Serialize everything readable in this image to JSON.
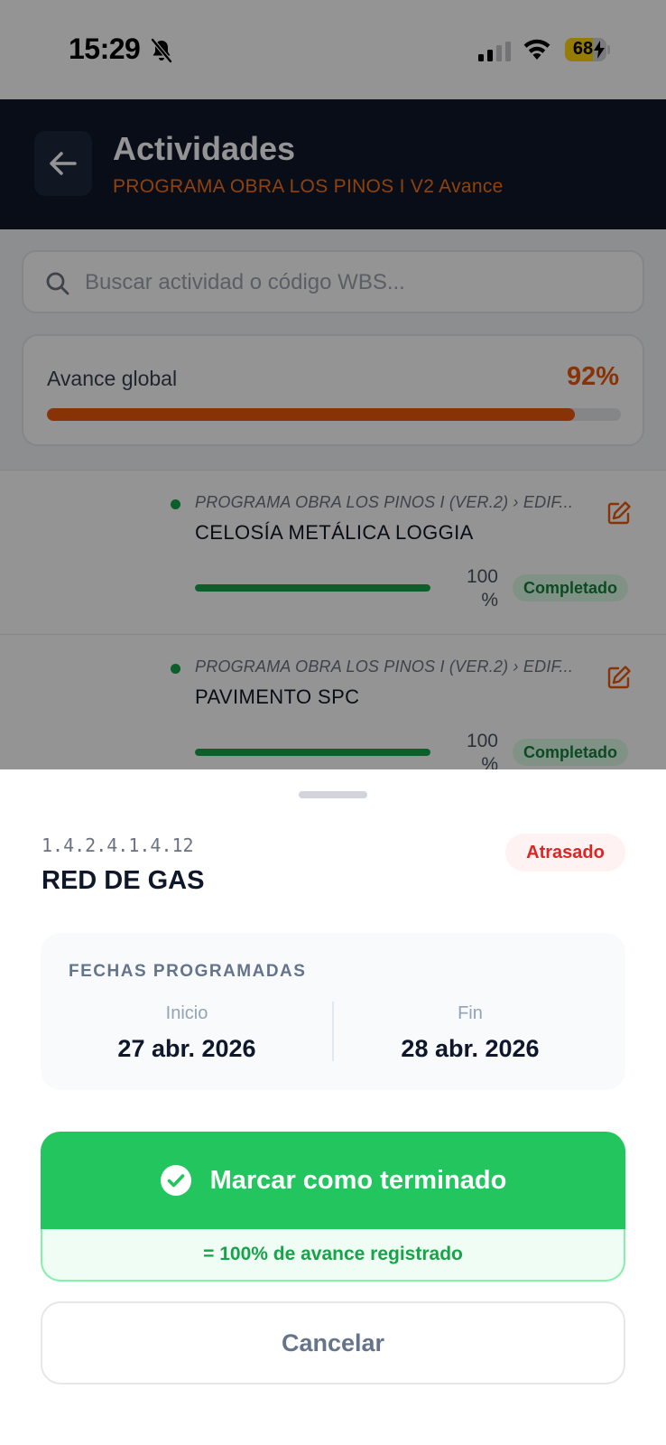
{
  "status_bar": {
    "time": "15:29",
    "battery": "68",
    "battery_level": 68,
    "icons": [
      "bell-slash-icon",
      "cellular-signal-icon",
      "wifi-icon",
      "battery-charging-icon"
    ]
  },
  "header": {
    "title": "Actividades",
    "subtitle": "PROGRAMA OBRA LOS PINOS I V2 Avance",
    "back_icon": "arrow-left-icon"
  },
  "search": {
    "placeholder": "Buscar actividad o código WBS..."
  },
  "global_progress": {
    "label": "Avance global",
    "value_text": "92%",
    "value": 92
  },
  "activities": [
    {
      "path": "PROGRAMA OBRA LOS PINOS I (VER.2) › EDIF...",
      "name": "CELOSÍA METÁLICA LOGGIA",
      "progress": 100,
      "percent_text": "100 %",
      "status": "Completado"
    },
    {
      "path": "PROGRAMA OBRA LOS PINOS I (VER.2) › EDIF...",
      "name": "PAVIMENTO SPC",
      "progress": 100,
      "percent_text": "100 %",
      "status": "Completado"
    }
  ],
  "sheet": {
    "wbs_code": "1.4.2.4.1.4.12",
    "title": "RED DE GAS",
    "status_badge": "Atrasado",
    "dates": {
      "heading": "FECHAS PROGRAMADAS",
      "start_label": "Inicio",
      "start_value": "27 abr. 2026",
      "end_label": "Fin",
      "end_value": "28 abr. 2026"
    },
    "finish_button": "Marcar como terminado",
    "finish_note": "= 100% de avance registrado",
    "cancel_button": "Cancelar"
  },
  "colors": {
    "header_bg": "#0f172a",
    "accent_orange": "#ea580c",
    "success_green": "#22c55e",
    "danger_red": "#dc2626"
  }
}
